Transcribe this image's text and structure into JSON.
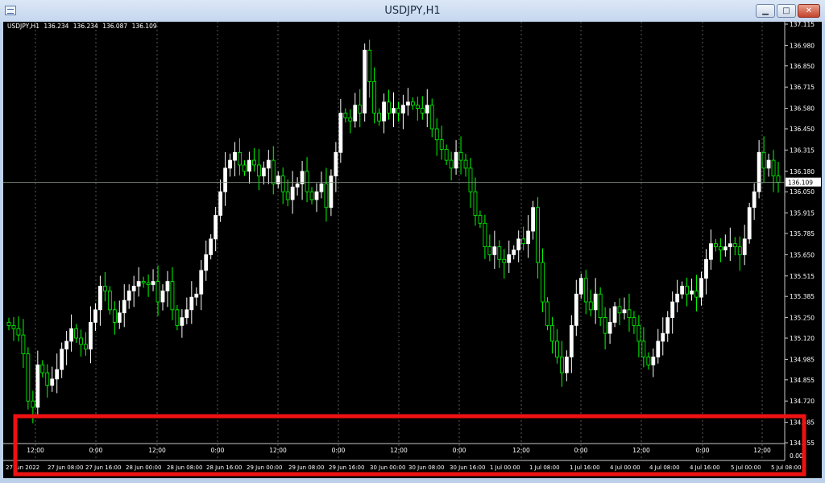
{
  "window": {
    "title": "USDJPY,H1",
    "minimize_glyph": "▁",
    "maximize_glyph": "□",
    "close_glyph": "✕"
  },
  "symbol_info": {
    "symbol": "USDJPY,H1",
    "open": "136.234",
    "high": "136.234",
    "low": "136.087",
    "close": "136.109"
  },
  "price_axis": {
    "labels": [
      "137.115",
      "136.980",
      "136.850",
      "136.715",
      "136.580",
      "136.450",
      "136.315",
      "136.180",
      "136.050",
      "135.915",
      "135.785",
      "135.650",
      "135.515",
      "135.385",
      "135.250",
      "135.120",
      "134.985",
      "134.855",
      "134.720",
      "134.585",
      "134.455"
    ],
    "current_price": "136.109",
    "bottom_scale": "0.00"
  },
  "time_axis": {
    "labels": [
      "27 Jun 2022",
      "27 Jun 08:00",
      "27 Jun 16:00",
      "28 Jun 00:00",
      "28 Jun 08:00",
      "28 Jun 16:00",
      "29 Jun 00:00",
      "29 Jun 08:00",
      "29 Jun 16:00",
      "30 Jun 00:00",
      "30 Jun 08:00",
      "30 Jun 16:00",
      "1 Jul 00:00",
      "1 Jul 08:00",
      "1 Jul 16:00",
      "4 Jul 00:00",
      "4 Jul 08:00",
      "4 Jul 16:00",
      "5 Jul 00:00",
      "5 Jul 08:00"
    ]
  },
  "subwindow_times": [
    "12:00",
    "0:00",
    "12:00",
    "0:00",
    "12:00",
    "0:00",
    "12:00",
    "0:00",
    "12:00",
    "0:00",
    "12:00",
    "0:00",
    "12:00"
  ],
  "colors": {
    "bull": "#ffffff",
    "bear": "#00ff00",
    "highlight": "#ee1111"
  }
}
